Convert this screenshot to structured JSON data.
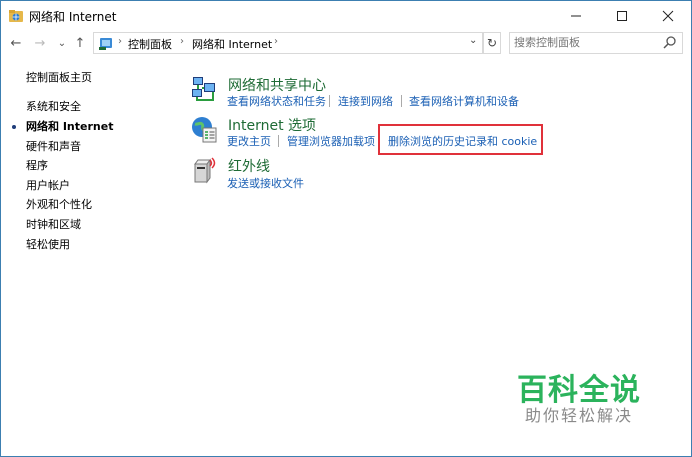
{
  "window": {
    "title": "网络和 Internet"
  },
  "address_bar": {
    "breadcrumbs": [
      "控制面板",
      "网络和 Internet"
    ],
    "search_placeholder": "搜索控制面板"
  },
  "sidebar": {
    "items": [
      {
        "label": "控制面板主页",
        "current": false
      },
      {
        "label": "系统和安全",
        "current": false
      },
      {
        "label": "网络和 Internet",
        "current": true
      },
      {
        "label": "硬件和声音",
        "current": false
      },
      {
        "label": "程序",
        "current": false
      },
      {
        "label": "用户帐户",
        "current": false
      },
      {
        "label": "外观和个性化",
        "current": false
      },
      {
        "label": "时钟和区域",
        "current": false
      },
      {
        "label": "轻松使用",
        "current": false
      }
    ]
  },
  "groups": [
    {
      "title": "网络和共享中心",
      "icon": "network-sharing-icon",
      "links": [
        "查看网络状态和任务",
        "连接到网络",
        "查看网络计算机和设备"
      ]
    },
    {
      "title": "Internet 选项",
      "icon": "internet-options-icon",
      "links": [
        "更改主页",
        "管理浏览器加载项",
        "删除浏览的历史记录和 cookie"
      ]
    },
    {
      "title": "红外线",
      "icon": "infrared-icon",
      "links": [
        "发送或接收文件"
      ]
    }
  ],
  "watermark": {
    "title": "百科全说",
    "subtitle": "助你轻松解决"
  },
  "colors": {
    "group_title": "#1e6b35",
    "link": "#1a5fb4",
    "highlight_border": "#e0313a",
    "watermark": "#2bb35c"
  }
}
